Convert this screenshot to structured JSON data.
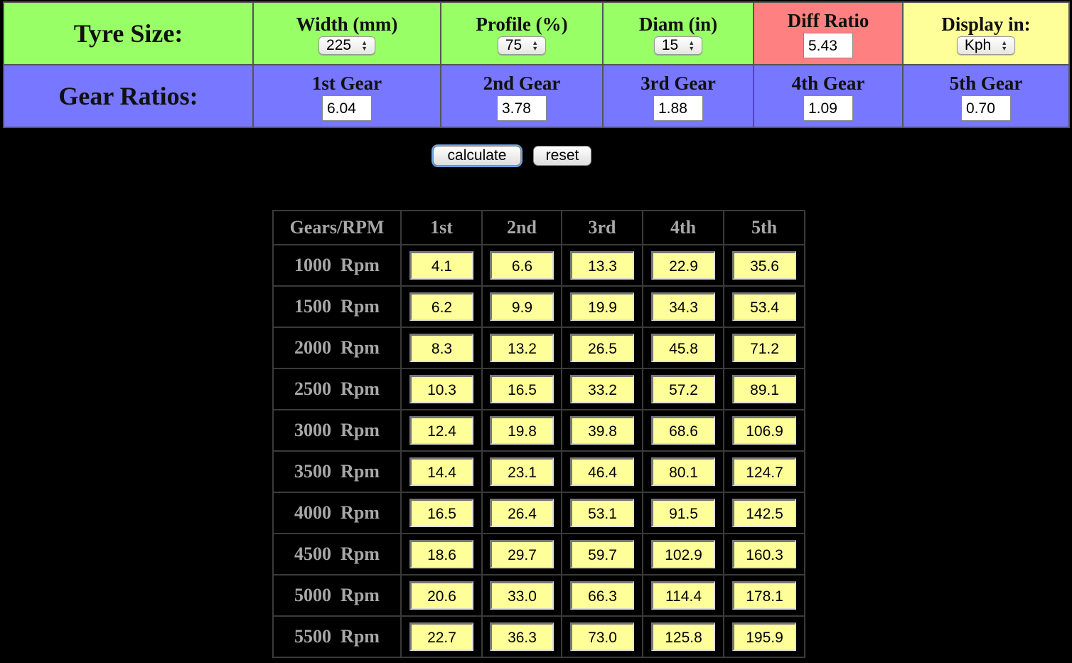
{
  "tyre_row": {
    "label": "Tyre Size:",
    "width": {
      "label": "Width (mm)",
      "value": "225"
    },
    "profile": {
      "label": "Profile (%)",
      "value": "75"
    },
    "diam": {
      "label": "Diam (in)",
      "value": "15"
    },
    "diff": {
      "label": "Diff Ratio",
      "value": "5.43"
    },
    "display": {
      "label": "Display in:",
      "value": "Kph"
    }
  },
  "gear_row": {
    "label": "Gear Ratios:",
    "gears": [
      {
        "label": "1st Gear",
        "value": "6.04"
      },
      {
        "label": "2nd Gear",
        "value": "3.78"
      },
      {
        "label": "3rd Gear",
        "value": "1.88"
      },
      {
        "label": "4th Gear",
        "value": "1.09"
      },
      {
        "label": "5th Gear",
        "value": "0.70"
      }
    ]
  },
  "buttons": {
    "calculate": "calculate",
    "reset": "reset"
  },
  "table": {
    "headers": [
      "Gears/RPM",
      "1st",
      "2nd",
      "3rd",
      "4th",
      "5th"
    ],
    "rows": [
      {
        "rpm": "1000",
        "unit": "Rpm",
        "speeds": [
          "4.1",
          "6.6",
          "13.3",
          "22.9",
          "35.6"
        ]
      },
      {
        "rpm": "1500",
        "unit": "Rpm",
        "speeds": [
          "6.2",
          "9.9",
          "19.9",
          "34.3",
          "53.4"
        ]
      },
      {
        "rpm": "2000",
        "unit": "Rpm",
        "speeds": [
          "8.3",
          "13.2",
          "26.5",
          "45.8",
          "71.2"
        ]
      },
      {
        "rpm": "2500",
        "unit": "Rpm",
        "speeds": [
          "10.3",
          "16.5",
          "33.2",
          "57.2",
          "89.1"
        ]
      },
      {
        "rpm": "3000",
        "unit": "Rpm",
        "speeds": [
          "12.4",
          "19.8",
          "39.8",
          "68.6",
          "106.9"
        ]
      },
      {
        "rpm": "3500",
        "unit": "Rpm",
        "speeds": [
          "14.4",
          "23.1",
          "46.4",
          "80.1",
          "124.7"
        ]
      },
      {
        "rpm": "4000",
        "unit": "Rpm",
        "speeds": [
          "16.5",
          "26.4",
          "53.1",
          "91.5",
          "142.5"
        ]
      },
      {
        "rpm": "4500",
        "unit": "Rpm",
        "speeds": [
          "18.6",
          "29.7",
          "59.7",
          "102.9",
          "160.3"
        ]
      },
      {
        "rpm": "5000",
        "unit": "Rpm",
        "speeds": [
          "20.6",
          "33.0",
          "66.3",
          "114.4",
          "178.1"
        ]
      },
      {
        "rpm": "5500",
        "unit": "Rpm",
        "speeds": [
          "22.7",
          "36.3",
          "73.0",
          "125.8",
          "195.9"
        ]
      }
    ]
  },
  "colors": {
    "tyre_bg": "#99ff66",
    "diff_bg": "#ff8080",
    "display_bg": "#ffff99",
    "gear_bg": "#7777ff",
    "speed_box_bg": "#ffff99",
    "page_bg": "#000000"
  }
}
